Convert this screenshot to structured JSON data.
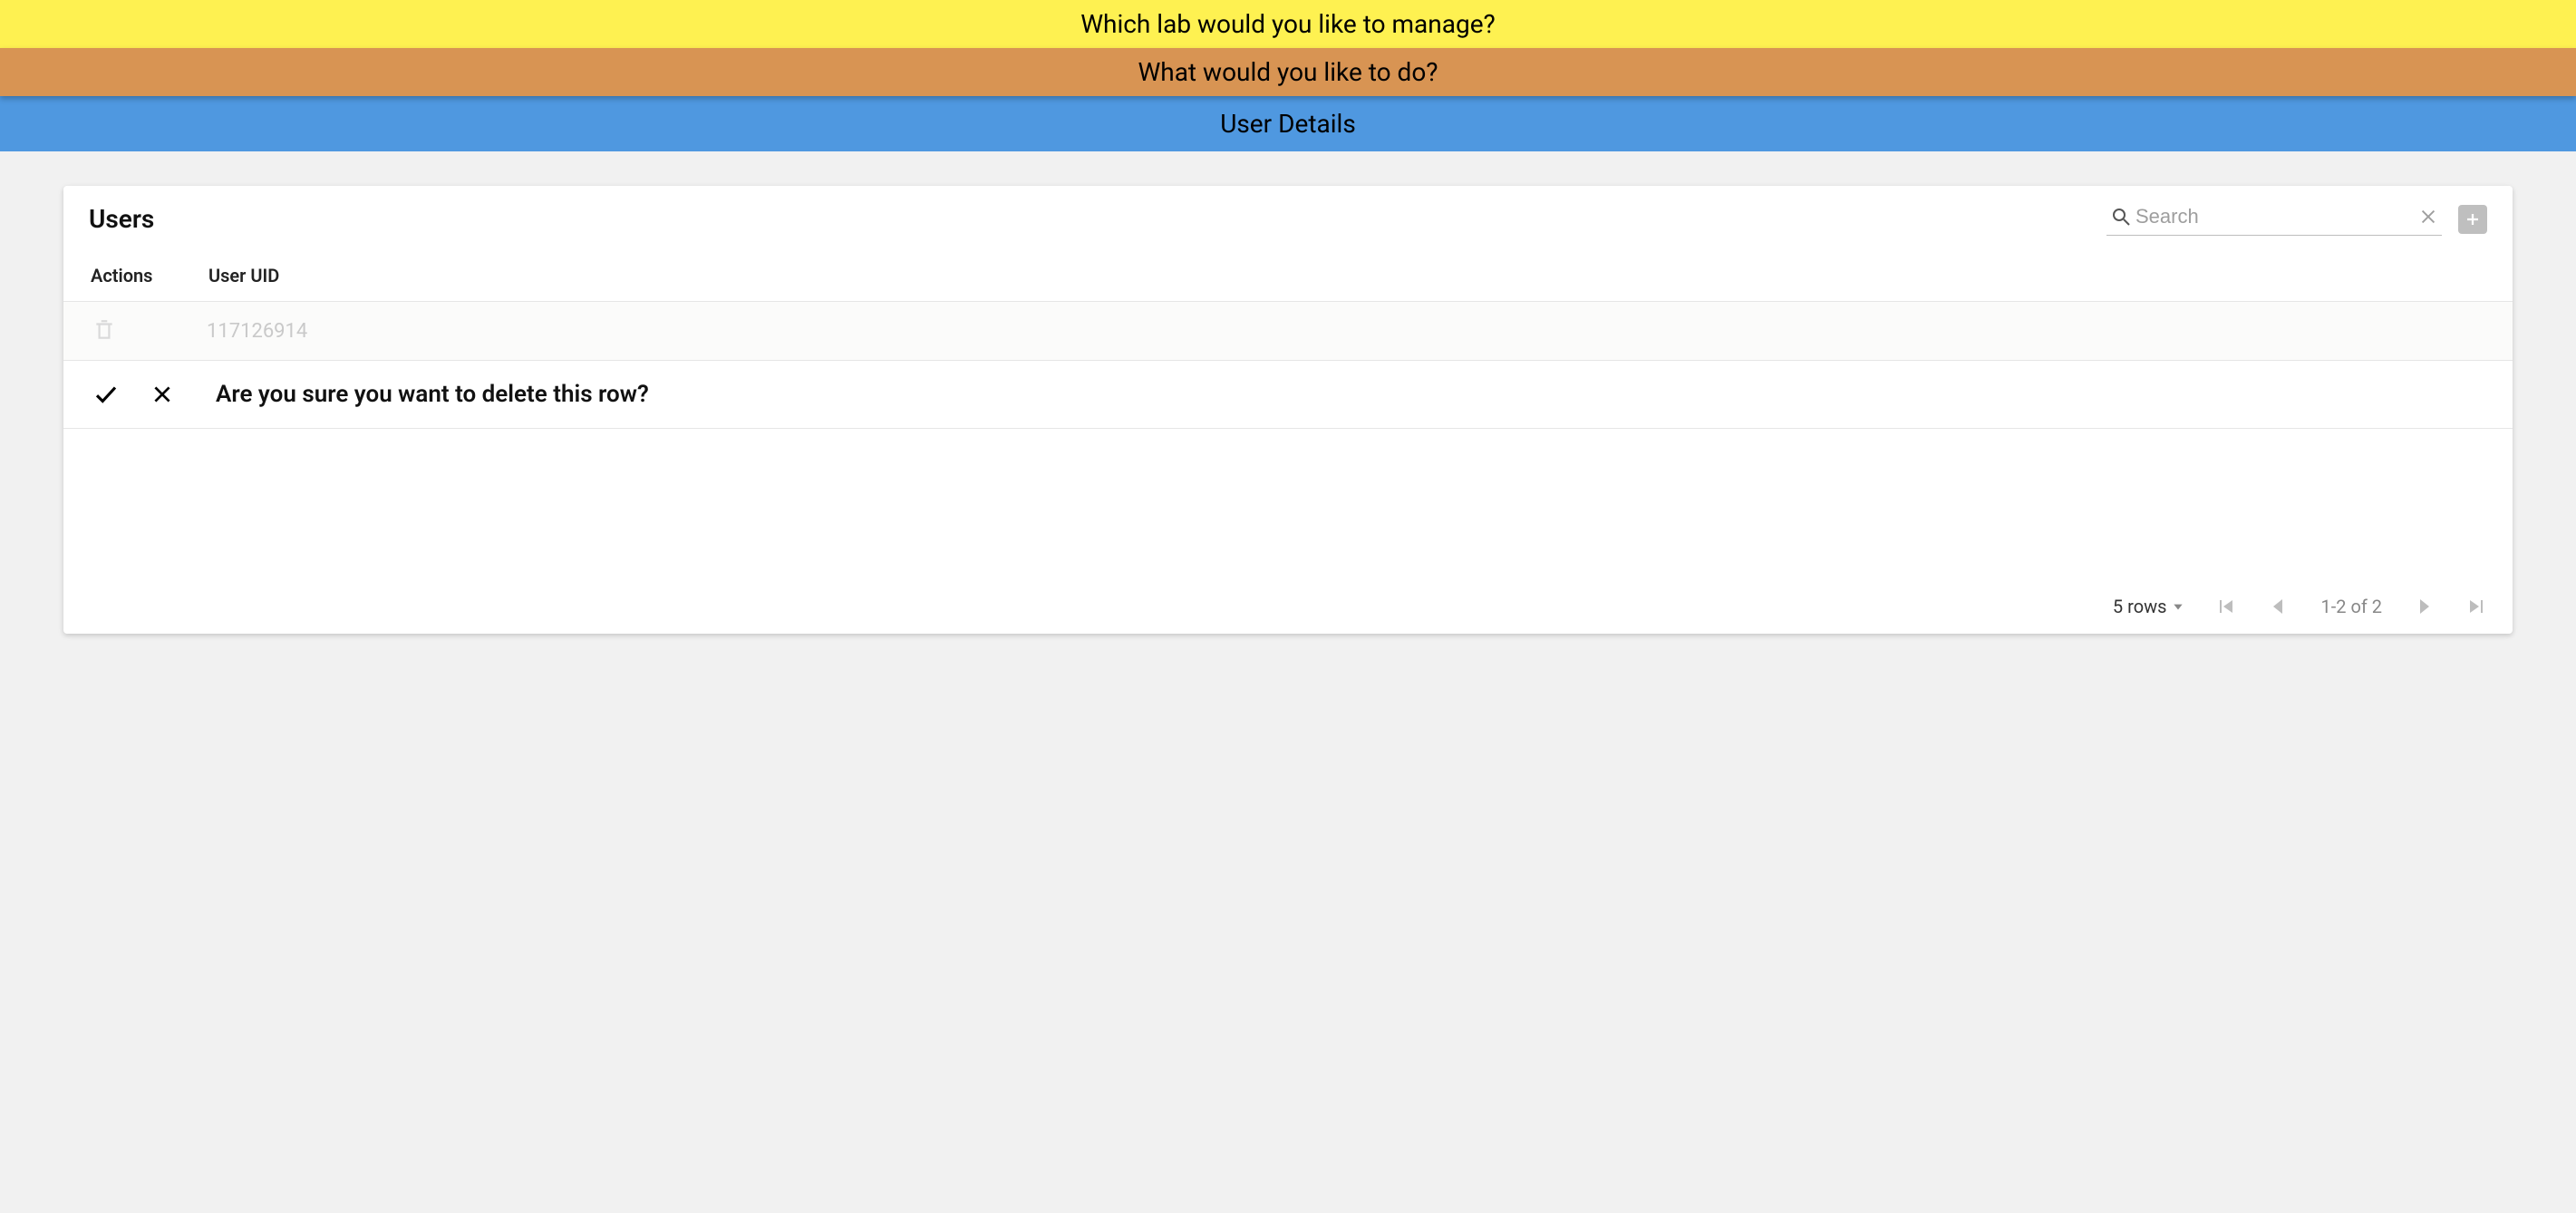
{
  "banners": {
    "yellow": "Which lab would you like to manage?",
    "orange": "What would you like to do?",
    "blue": "User Details"
  },
  "card": {
    "title": "Users",
    "search_placeholder": "Search",
    "columns": {
      "actions": "Actions",
      "uid": "User UID"
    },
    "rows": [
      {
        "uid": "117126914"
      }
    ],
    "confirm_message": "Are you sure you want to delete this row?",
    "footer": {
      "rows_label": "5 rows",
      "range": "1-2 of 2"
    }
  }
}
